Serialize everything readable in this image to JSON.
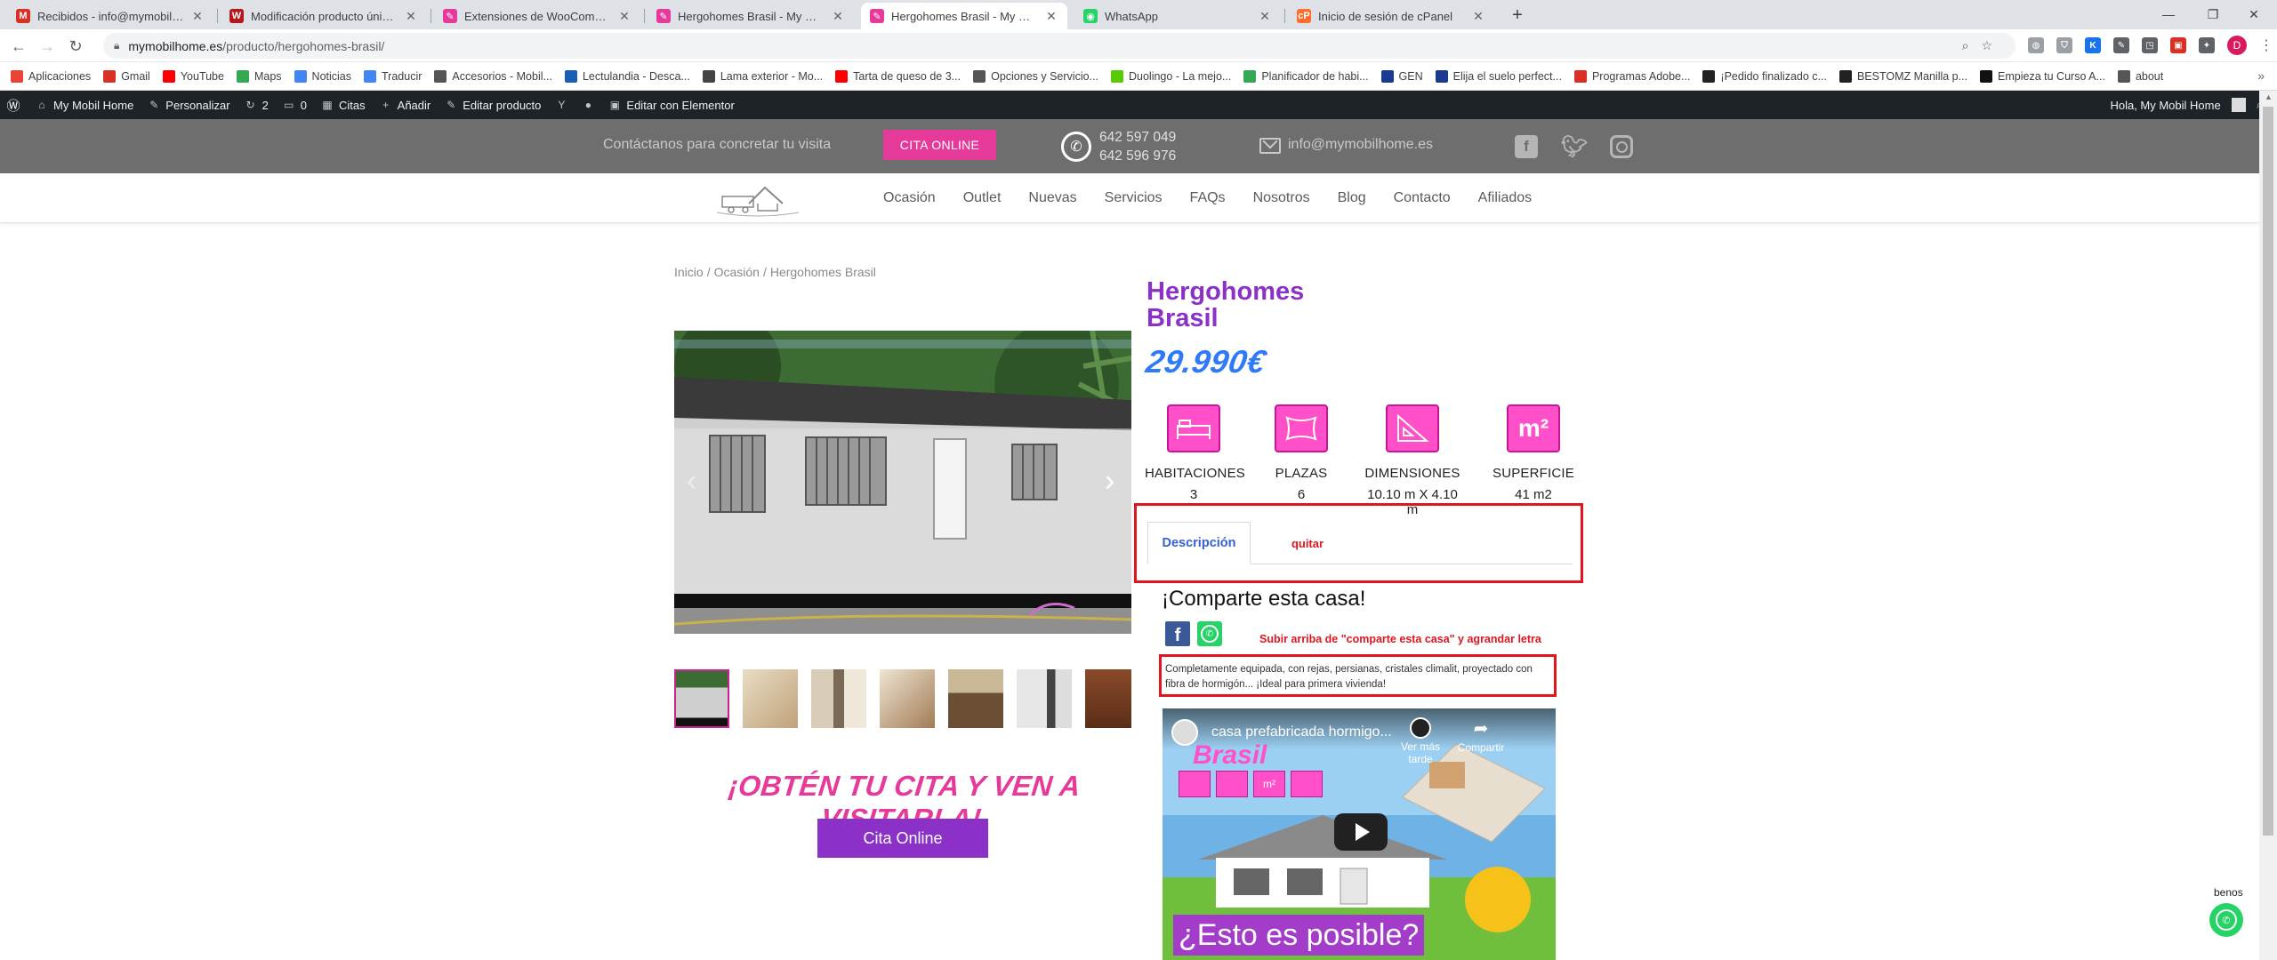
{
  "browser": {
    "tabs": [
      {
        "title": "Recibidos - info@mymobilhome.es",
        "color": "#d93025",
        "letter": "M"
      },
      {
        "title": "Modificación producto único – Ax",
        "color": "#b5171d",
        "letter": "W"
      },
      {
        "title": "Extensiones de WooCommerce «",
        "color": "#e63a9b",
        "letter": "✎"
      },
      {
        "title": "Hergohomes Brasil - My Mobil H",
        "color": "#e63a9b",
        "letter": "✎"
      },
      {
        "title": "Hergohomes Brasil - My Mobil H",
        "color": "#e63a9b",
        "letter": "✎",
        "active": true
      },
      {
        "title": "WhatsApp",
        "color": "#25d366",
        "letter": "◉"
      },
      {
        "title": "Inicio de sesión de cPanel",
        "color": "#ff6c2c",
        "letter": "cP"
      }
    ],
    "url_host": "mymobilhome.es",
    "url_path": "/producto/hergohomes-brasil/",
    "bookmarks": [
      {
        "label": "Aplicaciones",
        "color": "#ea4335"
      },
      {
        "label": "Gmail",
        "color": "#d93025"
      },
      {
        "label": "YouTube",
        "color": "#ff0000"
      },
      {
        "label": "Maps",
        "color": "#34a853"
      },
      {
        "label": "Noticias",
        "color": "#4285f4"
      },
      {
        "label": "Traducir",
        "color": "#4285f4"
      },
      {
        "label": "Accesorios - Mobil...",
        "color": "#555555"
      },
      {
        "label": "Lectulandia - Desca...",
        "color": "#1a5fb4"
      },
      {
        "label": "Lama exterior - Mo...",
        "color": "#444444"
      },
      {
        "label": "Tarta de queso de 3...",
        "color": "#ff0000"
      },
      {
        "label": "Opciones y Servicio...",
        "color": "#555555"
      },
      {
        "label": "Duolingo - La mejo...",
        "color": "#58cc02"
      },
      {
        "label": "Planificador de habi...",
        "color": "#34a853"
      },
      {
        "label": "GEN",
        "color": "#1a3a8f"
      },
      {
        "label": "Elija el suelo perfect...",
        "color": "#1a3a8f"
      },
      {
        "label": "Programas Adobe...",
        "color": "#d93025"
      },
      {
        "label": "¡Pedido finalizado c...",
        "color": "#222222"
      },
      {
        "label": "BESTOMZ Manilla p...",
        "color": "#222222"
      },
      {
        "label": "Empieza tu Curso A...",
        "color": "#111111"
      },
      {
        "label": "about",
        "color": "#555555"
      }
    ],
    "avatar_letter": "D"
  },
  "adminbar": {
    "items": [
      {
        "label": "My Mobil Home",
        "icon": "home-icon"
      },
      {
        "label": "Personalizar",
        "icon": "brush-icon"
      },
      {
        "label": "2",
        "icon": "refresh-icon"
      },
      {
        "label": "0",
        "icon": "comment-icon"
      },
      {
        "label": "Citas",
        "icon": "calendar-icon"
      },
      {
        "label": "Añadir",
        "icon": "plus-icon"
      },
      {
        "label": "Editar producto",
        "icon": "pencil-icon"
      },
      {
        "label": "",
        "icon": "yoast-icon"
      },
      {
        "label": "",
        "icon": "dot-icon"
      },
      {
        "label": "Editar con Elementor",
        "icon": "elementor-icon"
      }
    ],
    "greeting": "Hola, My Mobil Home"
  },
  "site": {
    "contact_text": "Contáctanos para concretar tu visita",
    "cita_label": "CITA ONLINE",
    "phone1": "642 597 049",
    "phone2": "642 596 976",
    "email": "info@mymobilhome.es",
    "nav": [
      "Ocasión",
      "Outlet",
      "Nuevas",
      "Servicios",
      "FAQs",
      "Nosotros",
      "Blog",
      "Contacto",
      "Afiliados"
    ]
  },
  "product": {
    "breadcrumb": [
      "Inicio",
      "Ocasión",
      "Hergohomes Brasil"
    ],
    "title": "Hergohomes Brasil",
    "price": "29.990€",
    "specs": [
      {
        "label": "HABITACIONES",
        "value": "3",
        "icon": "bed-icon"
      },
      {
        "label": "PLAZAS",
        "value": "6",
        "icon": "pillow-icon"
      },
      {
        "label": "DIMENSIONES",
        "value": "10.10 m X 4.10 m",
        "icon": "set-square-icon"
      },
      {
        "label": "SUPERFICIE",
        "value": "41 m2",
        "icon": "m2-icon",
        "glyph": "m²"
      }
    ],
    "tabs": [
      {
        "label": "Descripción",
        "active": true
      },
      {
        "label": "quitar",
        "active": false
      }
    ],
    "share_title": "¡Comparte esta casa!",
    "note": "Subir arriba de \"comparte esta casa\" y agrandar letra",
    "description": "Completamente equipada, con rejas, persianas, cristales climalit, proyectado con fibra de hormigón... ¡Ideal para primera vivienda!",
    "cta_title": "¡OBTÉN TU CITA Y VEN A VISITARLA!",
    "cta_button": "Cita Online",
    "thumbnail_count": 7
  },
  "video": {
    "title": "casa prefabricada hormigo...",
    "brasil": "Brasil",
    "watch_later": "Ver más tarde",
    "share": "Compartir",
    "question": "¿Esto es posible?",
    "icons": [
      "",
      "",
      "m²",
      ""
    ]
  },
  "floating": {
    "label": "benos"
  }
}
